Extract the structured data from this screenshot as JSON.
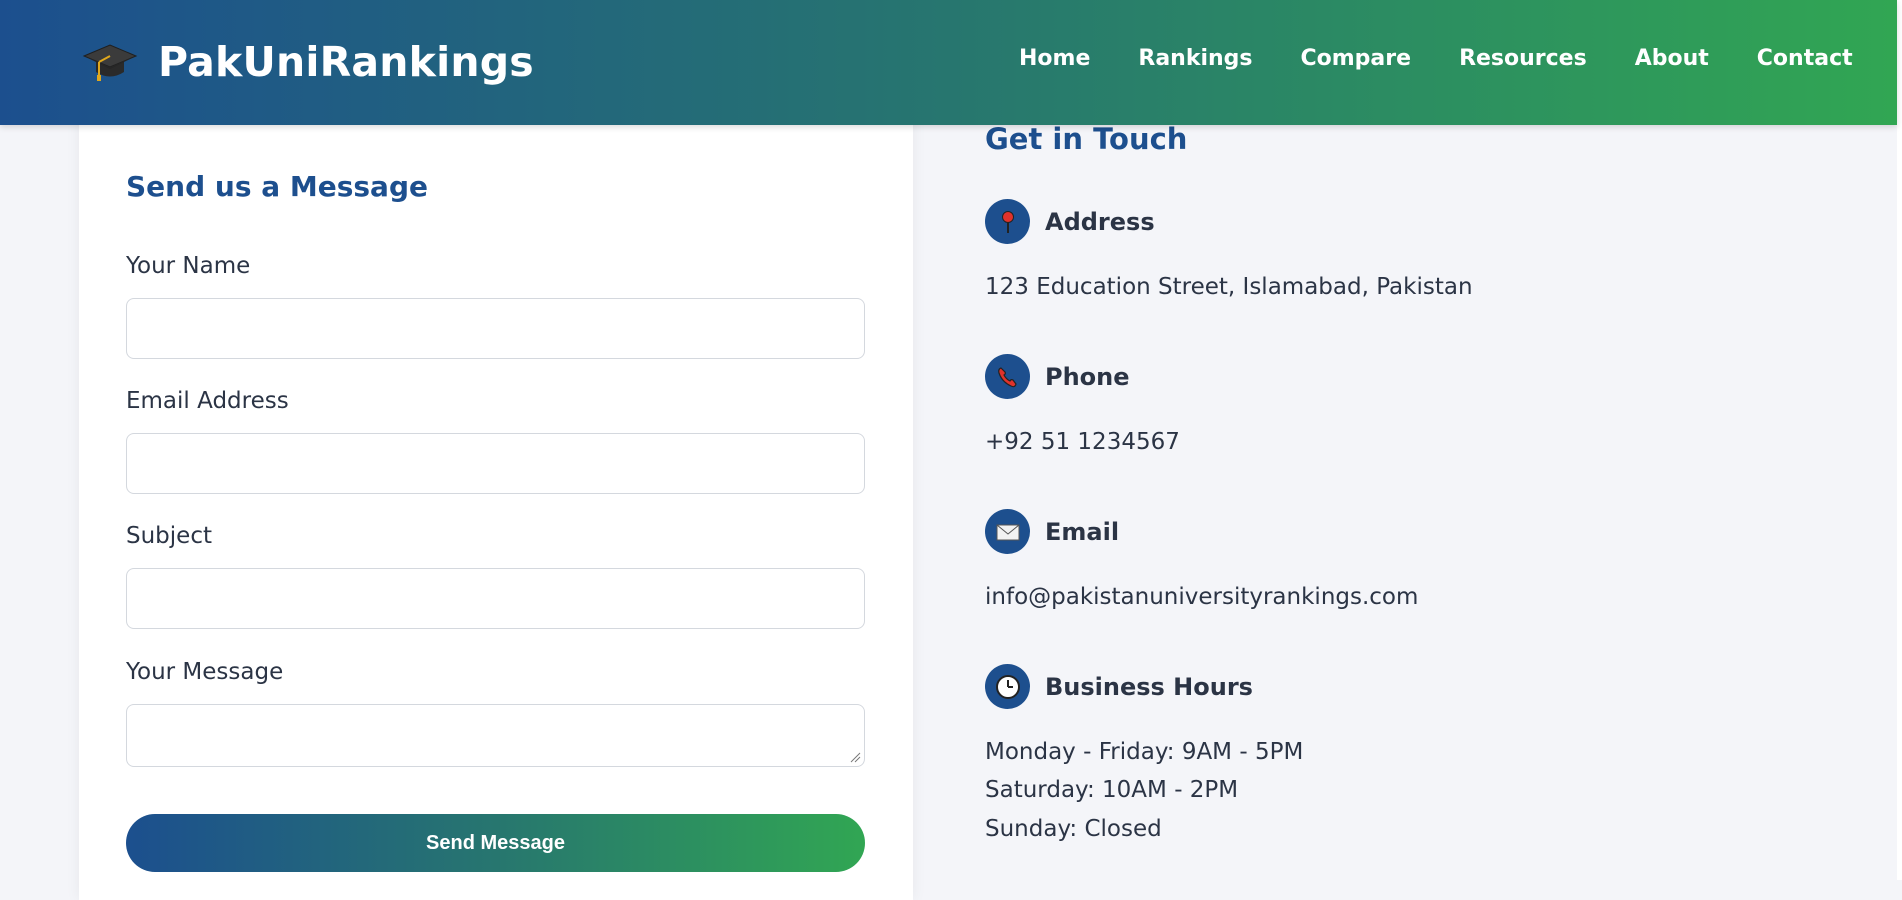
{
  "header": {
    "brand": "PakUniRankings",
    "logo_icon": "graduation-cap-icon",
    "nav": [
      "Home",
      "Rankings",
      "Compare",
      "Resources",
      "About",
      "Contact"
    ]
  },
  "form": {
    "title": "Send us a Message",
    "name_label": "Your Name",
    "email_label": "Email Address",
    "subject_label": "Subject",
    "message_label": "Your Message",
    "submit_label": "Send Message"
  },
  "contact": {
    "title": "Get in Touch",
    "address": {
      "icon": "pin-icon",
      "label": "Address",
      "value": "123 Education Street, Islamabad, Pakistan"
    },
    "phone": {
      "icon": "phone-icon",
      "label": "Phone",
      "value": "+92 51 1234567"
    },
    "email": {
      "icon": "envelope-icon",
      "label": "Email",
      "value": "info@pakistanuniversityrankings.com"
    },
    "hours": {
      "icon": "clock-icon",
      "label": "Business Hours",
      "lines": [
        "Monday - Friday: 9AM - 5PM",
        "Saturday: 10AM - 2PM",
        "Sunday: Closed"
      ]
    }
  },
  "colors": {
    "primary": "#1d4f8e",
    "accent": "#31a653",
    "background": "#f4f5f9"
  }
}
